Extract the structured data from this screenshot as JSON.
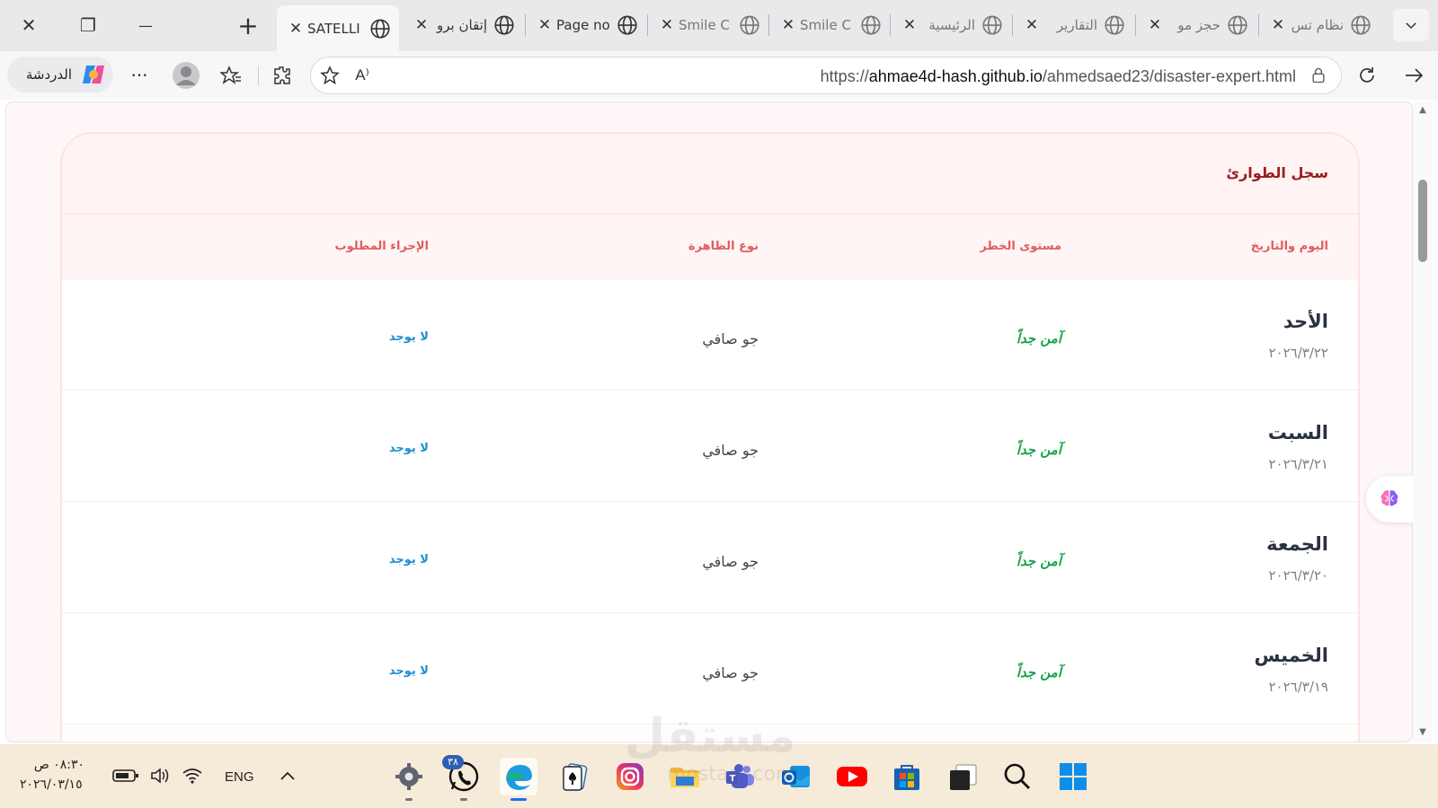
{
  "browser": {
    "window_controls": {
      "close": "✕",
      "restore": "❐",
      "minimize": "—",
      "new_tab": "+"
    },
    "tabs": [
      {
        "title": "SATELLI",
        "active": true
      },
      {
        "title": "إتقان برو",
        "active": false
      },
      {
        "title": "Page no",
        "active": false
      },
      {
        "title": "Smile C",
        "active": false
      },
      {
        "title": "Smile C",
        "active": false
      },
      {
        "title": "الرئيسية",
        "active": false
      },
      {
        "title": "التقارير",
        "active": false
      },
      {
        "title": "حجز مو",
        "active": false
      },
      {
        "title": "نظام تس",
        "active": false
      }
    ],
    "copilot_label": "الدردشة",
    "more_label": "···",
    "url_prefix": "https://",
    "url_host": "ahmae4d-hash.github.io",
    "url_path": "/ahmedsaed23/disaster-expert.html",
    "read_aloud_label": "A⁾"
  },
  "page": {
    "card_title": "سجل الطوارئ",
    "columns": {
      "day_date": "اليوم والتاريخ",
      "risk": "مستوى الخطر",
      "phenomenon": "نوع الظاهرة",
      "action": "الإجراء المطلوب"
    },
    "rows": [
      {
        "day": "الأحد",
        "date": "٢٠٢٦/٣/٢٢",
        "risk": "آمن جداً",
        "phenomenon": "جو صافي",
        "action": "لا يوجد"
      },
      {
        "day": "السبت",
        "date": "٢٠٢٦/٣/٢١",
        "risk": "آمن جداً",
        "phenomenon": "جو صافي",
        "action": "لا يوجد"
      },
      {
        "day": "الجمعة",
        "date": "٢٠٢٦/٣/٢٠",
        "risk": "آمن جداً",
        "phenomenon": "جو صافي",
        "action": "لا يوجد"
      },
      {
        "day": "الخميس",
        "date": "٢٠٢٦/٣/١٩",
        "risk": "آمن جداً",
        "phenomenon": "جو صافي",
        "action": "لا يوجد"
      }
    ],
    "colors": {
      "title": "#9b1c1c",
      "header_text": "#e05d5d",
      "risk_safe": "#16a34a",
      "action": "#1d8fcf",
      "page_bg": "#fff7f7"
    }
  },
  "taskbar": {
    "time": "٠٨:٣٠ ص",
    "date": "٢٠٢٦/٠٣/١٥",
    "language": "ENG",
    "whatsapp_badge": "٣٨",
    "apps": [
      "settings-icon",
      "whatsapp-icon",
      "edge-icon",
      "solitaire-icon",
      "instagram-icon",
      "file-explorer-icon",
      "teams-icon",
      "outlook-icon",
      "youtube-icon",
      "microsoft-store-icon",
      "task-view-icon",
      "search-icon",
      "start-icon"
    ],
    "watermark": "مستقل",
    "watermark_sub": "mostaql.com"
  }
}
